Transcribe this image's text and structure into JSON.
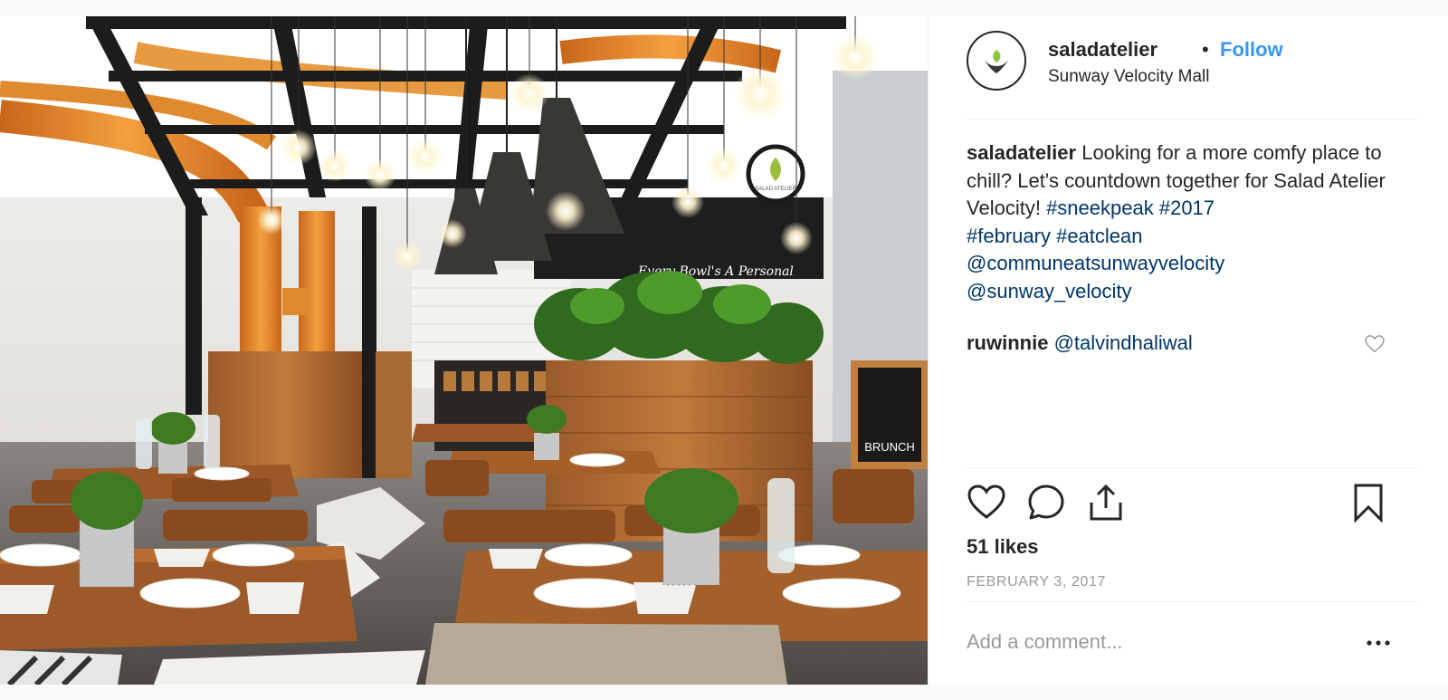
{
  "post": {
    "photo": {
      "sign_logo_text": "SALAD ATELIER",
      "wall_script_text": "Every Bowl's A Personal",
      "chalkboard_text": "BRUNCH"
    },
    "header": {
      "username": "saladatelier",
      "dot": "•",
      "follow_label": "Follow",
      "location": "Sunway Velocity Mall",
      "avatar_icon": "salad-atelier-logo-icon"
    },
    "caption": {
      "username": "saladatelier",
      "text": "Looking for a more comfy place to chill? Let's countdown together for Salad Atelier Velocity!",
      "hashtags": [
        "#sneekpeak",
        "#2017",
        "#february",
        "#eatclean"
      ],
      "mentions": [
        "@communeatsunwayvelocity",
        "@sunway_velocity"
      ]
    },
    "comments": [
      {
        "username": "ruwinnie",
        "mention": "@talvindhaliwal",
        "icon": "heart-outline-icon"
      }
    ],
    "actions": {
      "like_icon": "heart-outline-icon",
      "comment_icon": "speech-bubble-icon",
      "share_icon": "share-upload-icon",
      "save_icon": "bookmark-outline-icon"
    },
    "likes_label": "51 likes",
    "date_label": "FEBRUARY 3, 2017",
    "add_comment_placeholder": "Add a comment...",
    "more_icon": "ellipsis-icon",
    "colors": {
      "link_blue": "#3897f0",
      "tag_blue": "#003569",
      "text": "#262626",
      "muted": "#999999",
      "divider": "#efefef"
    }
  }
}
